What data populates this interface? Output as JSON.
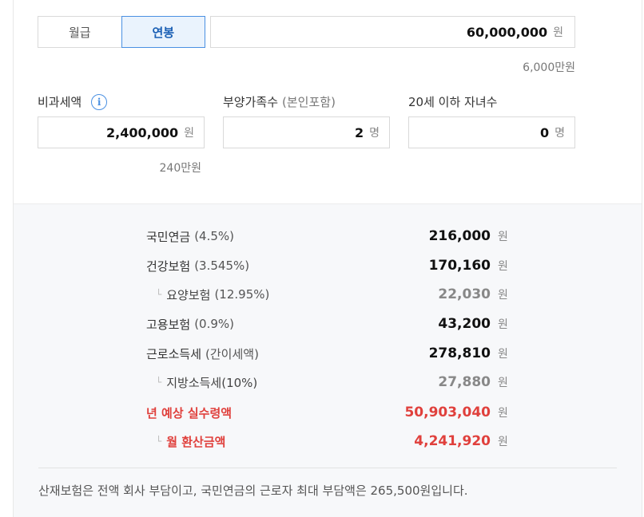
{
  "toggle": {
    "monthly": "월급",
    "annual": "연봉",
    "selected": "연봉"
  },
  "salary": {
    "value": "60,000,000",
    "unit": "원",
    "sub": "6,000만원"
  },
  "nontax": {
    "label": "비과세액",
    "value": "2,400,000",
    "unit": "원",
    "sub": "240만원",
    "info_icon": "info-icon"
  },
  "dependents": {
    "label": "부양가족수",
    "label_paren": "(본인포함)",
    "value": "2",
    "unit": "명"
  },
  "children": {
    "label": "20세 이하 자녀수",
    "value": "0",
    "unit": "명"
  },
  "results": [
    {
      "name": "국민연금",
      "pct": "(4.5%)",
      "amount": "216,000",
      "unit": "원",
      "sub": false,
      "red": false
    },
    {
      "name": "건강보험",
      "pct": "(3.545%)",
      "amount": "170,160",
      "unit": "원",
      "sub": false,
      "red": false
    },
    {
      "name": "요양보험",
      "pct": "(12.95%)",
      "amount": "22,030",
      "unit": "원",
      "sub": true,
      "red": false
    },
    {
      "name": "고용보험",
      "pct": "(0.9%)",
      "amount": "43,200",
      "unit": "원",
      "sub": false,
      "red": false
    },
    {
      "name": "근로소득세",
      "pct": "(간이세액)",
      "amount": "278,810",
      "unit": "원",
      "sub": false,
      "red": false
    },
    {
      "name": "지방소득세(10%)",
      "pct": "",
      "amount": "27,880",
      "unit": "원",
      "sub": true,
      "red": false
    },
    {
      "name": "년 예상 실수령액",
      "pct": "",
      "amount": "50,903,040",
      "unit": "원",
      "sub": false,
      "red": true
    },
    {
      "name": "월 환산금액",
      "pct": "",
      "amount": "4,241,920",
      "unit": "원",
      "sub": true,
      "red": true
    }
  ],
  "note": "산재보험은 전액 회사 부담이고, 국민연금의 근로자 최대 부담액은 265,500원입니다.",
  "colors": {
    "accent": "#4a90e2",
    "highlight": "#e0403c",
    "panel": "#f7f8fa"
  }
}
